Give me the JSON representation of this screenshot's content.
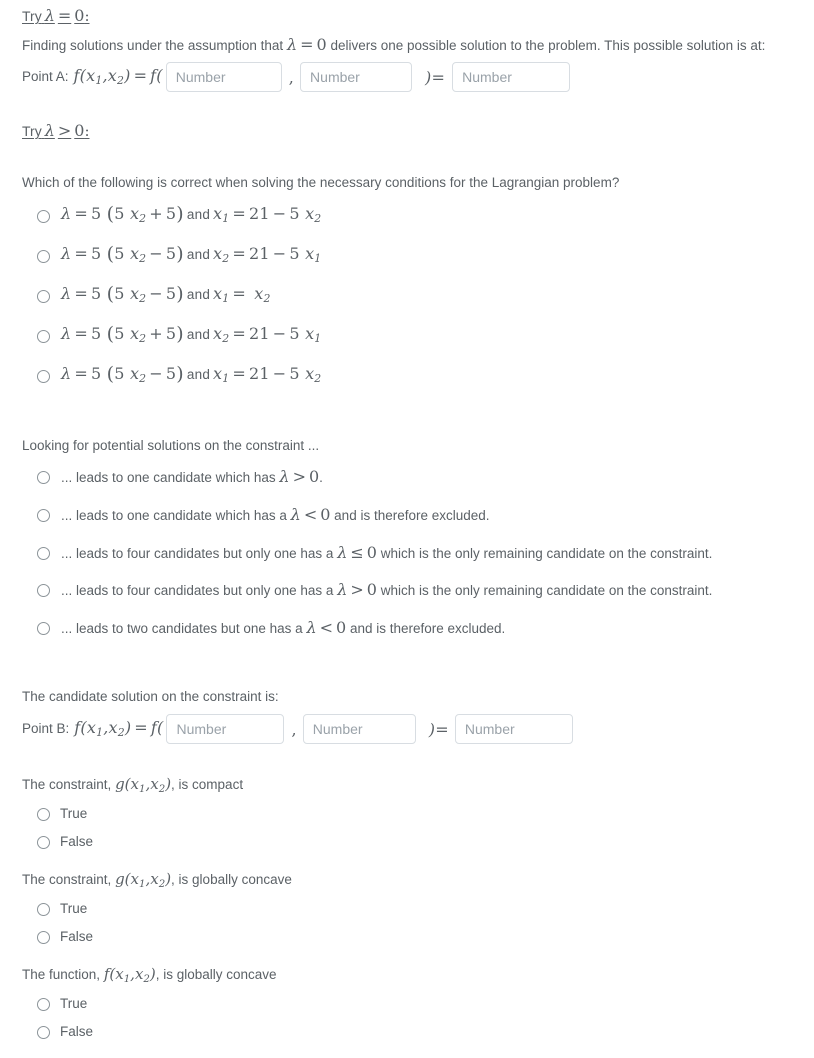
{
  "sections": {
    "try_lambda_zero": {
      "heading_prefix": "Try",
      "heading_math": "λ = 0:",
      "paragraph_before": "Finding solutions under the assumption that",
      "paragraph_math": "λ = 0",
      "paragraph_after": "delivers one possible solution to the problem. This possible solution is at:",
      "point_label": "Point A:",
      "point_math_lhs": "f(x1,x2) = f(",
      "comma": ",",
      "close_equals": ")=",
      "input_placeholder": "Number"
    },
    "try_lambda_positive": {
      "heading_prefix": "Try",
      "heading_math": "λ > 0:",
      "question": "Which of the following is correct when solving the necessary conditions for the Lagrangian problem?",
      "options": [
        {
          "id": "opt-a",
          "lambda_expr": "λ = 5 (5 x2 + 5)",
          "conjunction": "and",
          "second_expr": "x1 = 21 − 5 x2"
        },
        {
          "id": "opt-b",
          "lambda_expr": "λ = 5 (5 x2 − 5)",
          "conjunction": "and",
          "second_expr": "x2 = 21 − 5 x1"
        },
        {
          "id": "opt-c",
          "lambda_expr": "λ = 5 (5 x2 − 5)",
          "conjunction": "and",
          "second_expr": "x1 = x2"
        },
        {
          "id": "opt-d",
          "lambda_expr": "λ = 5 (5 x2 + 5)",
          "conjunction": "and",
          "second_expr": "x2 = 21 − 5 x1"
        },
        {
          "id": "opt-e",
          "lambda_expr": "λ = 5 (5 x2 − 5)",
          "conjunction": "and",
          "second_expr": "x1 = 21 − 5 x2"
        }
      ]
    },
    "constraint_search": {
      "prompt": "Looking for potential solutions on the constraint ...",
      "options": [
        {
          "id": "cand-1",
          "pre": "... leads to one candidate which has",
          "math": "λ > 0",
          "post": "."
        },
        {
          "id": "cand-2",
          "pre": "... leads to one candidate which has a",
          "math": "λ < 0",
          "post": "and is therefore excluded."
        },
        {
          "id": "cand-3",
          "pre": "... leads to four candidates but only one has a",
          "math": "λ ≤ 0",
          "post": "which is the only remaining candidate on the constraint."
        },
        {
          "id": "cand-4",
          "pre": "... leads to four candidates but only one has a",
          "math": "λ > 0",
          "post": "which is the only remaining candidate on the constraint."
        },
        {
          "id": "cand-5",
          "pre": "... leads to two candidates but one has a",
          "math": "λ < 0",
          "post": "and is therefore excluded."
        }
      ]
    },
    "candidate_solution": {
      "prompt": "The candidate solution on the constraint is:",
      "point_label": "Point B:",
      "input_placeholder": "Number",
      "comma": ",",
      "close_equals": ")="
    },
    "true_false_blocks": [
      {
        "id": "tf-constraint-compact",
        "pre": "The constraint,",
        "math": "g(x1,x2)",
        "post": ", is compact",
        "true_label": "True",
        "false_label": "False"
      },
      {
        "id": "tf-constraint-concave",
        "pre": "The constraint,",
        "math": "g(x1,x2)",
        "post": ", is globally concave",
        "true_label": "True",
        "false_label": "False"
      },
      {
        "id": "tf-function-concave",
        "pre": "The function,",
        "math": "f(x1,x2)",
        "post": ", is globally concave",
        "true_label": "True",
        "false_label": "False"
      }
    ]
  },
  "colors": {
    "text": "#5b6166",
    "placeholder": "#9aa2a9",
    "input_border": "#d8dde2",
    "radio_border": "#8c9499",
    "background": "#ffffff"
  }
}
